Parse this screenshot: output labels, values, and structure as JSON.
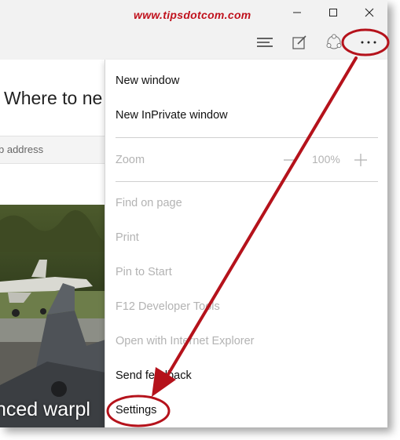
{
  "watermark": "www.tipsdotcom.com",
  "window_controls": {
    "minimize_icon": "minimize-icon",
    "maximize_icon": "maximize-icon",
    "close_icon": "close-icon"
  },
  "toolbar": {
    "icons": [
      "hub-icon",
      "web-note-icon",
      "share-icon",
      "more-actions-icon"
    ]
  },
  "page": {
    "headline": "Where to ne",
    "search_placeholder": "b address",
    "photo_caption": "nced warpl"
  },
  "menu": {
    "items": [
      {
        "label": "New window",
        "enabled": true
      },
      {
        "label": "New InPrivate window",
        "enabled": true
      },
      {
        "label": "Find on page",
        "enabled": false
      },
      {
        "label": "Print",
        "enabled": false
      },
      {
        "label": "Pin to Start",
        "enabled": false
      },
      {
        "label": "F12 Developer Tools",
        "enabled": false
      },
      {
        "label": "Open with Internet Explorer",
        "enabled": false
      },
      {
        "label": "Send feedback",
        "enabled": true
      },
      {
        "label": "Settings",
        "enabled": true
      }
    ],
    "zoom": {
      "label": "Zoom",
      "value": "100%",
      "minus": "−",
      "plus": "+"
    }
  },
  "colors": {
    "annotation_red": "#b5121b",
    "watermark_red": "#c0121d",
    "chrome_bg": "#f2f2f2",
    "disabled_text": "#b3b3b3"
  }
}
